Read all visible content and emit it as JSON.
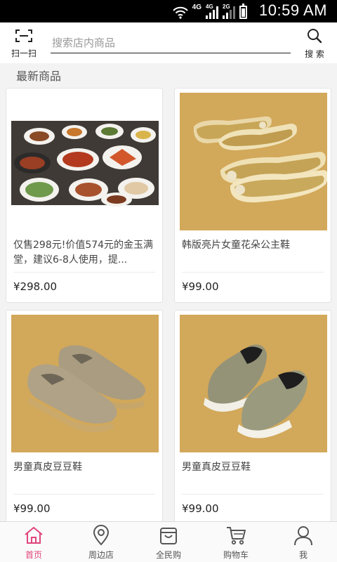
{
  "status_bar": {
    "time": "10:59 AM",
    "network_1": "4G",
    "network_2": "4G",
    "network_3": "2G"
  },
  "header": {
    "scan_label": "扫一扫",
    "search_placeholder": "搜索店内商品",
    "search_label": "搜 索"
  },
  "section_title": "最新商品",
  "products": [
    {
      "name": "仅售298元!价值574元的金玉满堂，建议6-8人使用，提...",
      "price": "¥298.00",
      "image": "banquet-dishes"
    },
    {
      "name": "韩版亮片女童花朵公主鞋",
      "price": "¥99.00",
      "image": "gold-princess-shoes"
    },
    {
      "name": "男童真皮豆豆鞋",
      "price": "¥99.00",
      "image": "khaki-loafers"
    },
    {
      "name": "男童真皮豆豆鞋",
      "price": "¥99.00",
      "image": "olive-slip-on-shoes"
    }
  ],
  "tabs": [
    {
      "label": "首页",
      "icon": "home-icon",
      "active": true
    },
    {
      "label": "周边店",
      "icon": "location-pin-icon",
      "active": false
    },
    {
      "label": "全民购",
      "icon": "shopping-bag-icon",
      "active": false
    },
    {
      "label": "购物车",
      "icon": "cart-icon",
      "active": false
    },
    {
      "label": "我",
      "icon": "person-icon",
      "active": false
    }
  ],
  "colors": {
    "accent": "#e0457b",
    "card_background": "#d2a85a"
  }
}
